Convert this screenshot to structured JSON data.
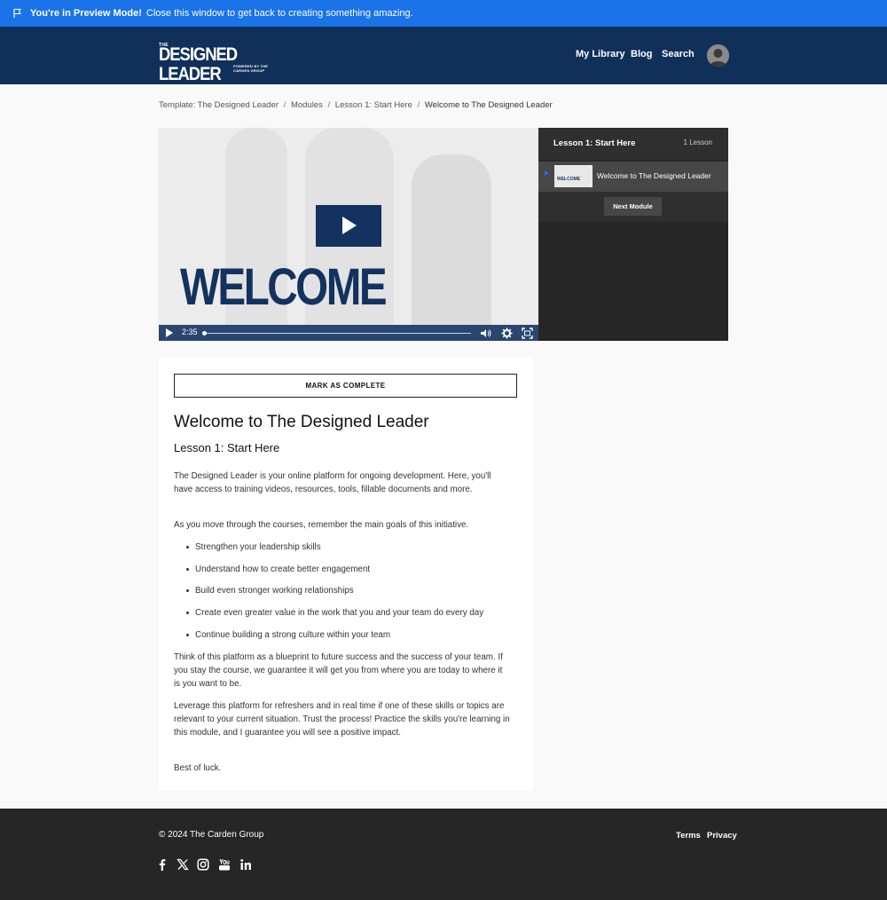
{
  "preview": {
    "title": "You're in Preview Mode!",
    "message": "Close this window to get back to creating something amazing.",
    "color": "#1a73e8"
  },
  "header": {
    "logo_the": "THE",
    "logo_main": "DESIGNED LEADER",
    "logo_sub": "POWERED BY THE CARDEN GROUP",
    "nav": [
      "My Library",
      "Blog",
      "Search"
    ],
    "bg": "#10305a"
  },
  "breadcrumb": {
    "items": [
      "Template: The Designed Leader",
      "Modules",
      "Lesson 1: Start Here"
    ],
    "current": "Welcome to The Designed Leader",
    "separator": "/"
  },
  "video": {
    "overlay_text": "WELCOME",
    "time": "2:35",
    "progress": 0.0
  },
  "playlist": {
    "title": "Lesson 1: Start Here",
    "count": "1 Lesson",
    "item_label": "Welcome to The Designed Leader",
    "thumb_text": "WELCOME",
    "next_label": "Next Module"
  },
  "content": {
    "mark_complete": "MARK AS COMPLETE",
    "title": "Welcome to The Designed Leader",
    "subtitle": "Lesson 1: Start Here",
    "p1": "The Designed Leader is your online platform for ongoing development. Here, you'll have access to training videos, resources, tools, fillable documents and more.",
    "p2": "As you move through the courses, remember the main goals of this initiative.",
    "bullets": [
      "Strengthen your leadership skills",
      "Understand how to create better engagement",
      "Build even stronger working relationships",
      "Create even greater value in the work that you and your team do every day",
      "Continue building a strong culture within your team"
    ],
    "p3": "Think of this platform as a blueprint to future success and the success of your team. If you stay the course, we guarantee it will get you from where you are today to where it is you want to be.",
    "p4": "Leverage this platform for refreshers and in real time if one of these skills or topics are relevant to your current situation. Trust the process! Practice the skills you're learning in this module, and I guarantee you will see a positive impact.",
    "p5": "Best of luck."
  },
  "footer": {
    "copyright": "© 2024 The Carden Group",
    "links": [
      "Terms",
      "Privacy"
    ],
    "social_icons": [
      "facebook-icon",
      "x-icon",
      "instagram-icon",
      "youtube-icon",
      "linkedin-icon"
    ]
  }
}
